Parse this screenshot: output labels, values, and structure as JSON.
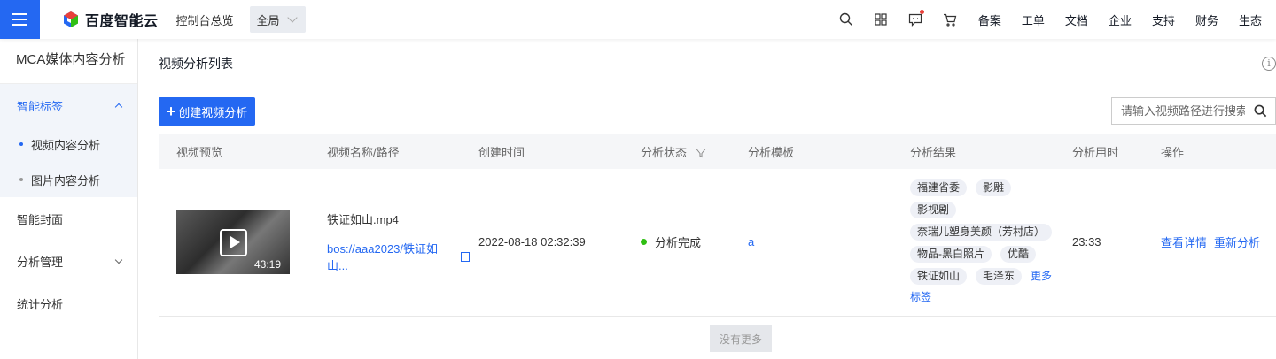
{
  "topbar": {
    "brand": "百度智能云",
    "overview": "控制台总览",
    "region": "全局",
    "nav_links": [
      "备案",
      "工单",
      "文档",
      "企业",
      "支持",
      "财务",
      "生态"
    ],
    "icons": [
      "search-icon",
      "apps-grid-icon",
      "message-icon",
      "cart-icon"
    ],
    "accent_color": "#2468f2"
  },
  "sidebar": {
    "title": "MCA媒体内容分析",
    "group_smart_tags": "智能标签",
    "sub_video": "视频内容分析",
    "sub_image": "图片内容分析",
    "smart_cover": "智能封面",
    "analysis_mgmt": "分析管理",
    "stats": "统计分析"
  },
  "main": {
    "title": "视频分析列表",
    "create_button": "创建视频分析",
    "search_placeholder": "请输入视频路径进行搜索",
    "columns": [
      "视频预览",
      "视频名称/路径",
      "创建时间",
      "分析状态",
      "分析模板",
      "分析结果",
      "分析用时",
      "操作"
    ],
    "row": {
      "duration": "43:19",
      "file_name": "铁证如山.mp4",
      "file_path": "bos://aaa2023/铁证如山...",
      "created": "2022-08-18 02:32:39",
      "status": "分析完成",
      "template": "a",
      "tags": [
        "福建省委",
        "影雕",
        "影视剧",
        "奈瑞儿塑身美颜（芳村店）",
        "物品-黑白照片",
        "优酷",
        "铁证如山",
        "毛泽东"
      ],
      "more_a": "更多",
      "more_b": "标签",
      "elapsed": "23:33",
      "op_detail": "查看详情",
      "op_reanalyze": "重新分析"
    },
    "no_more": "没有更多"
  }
}
